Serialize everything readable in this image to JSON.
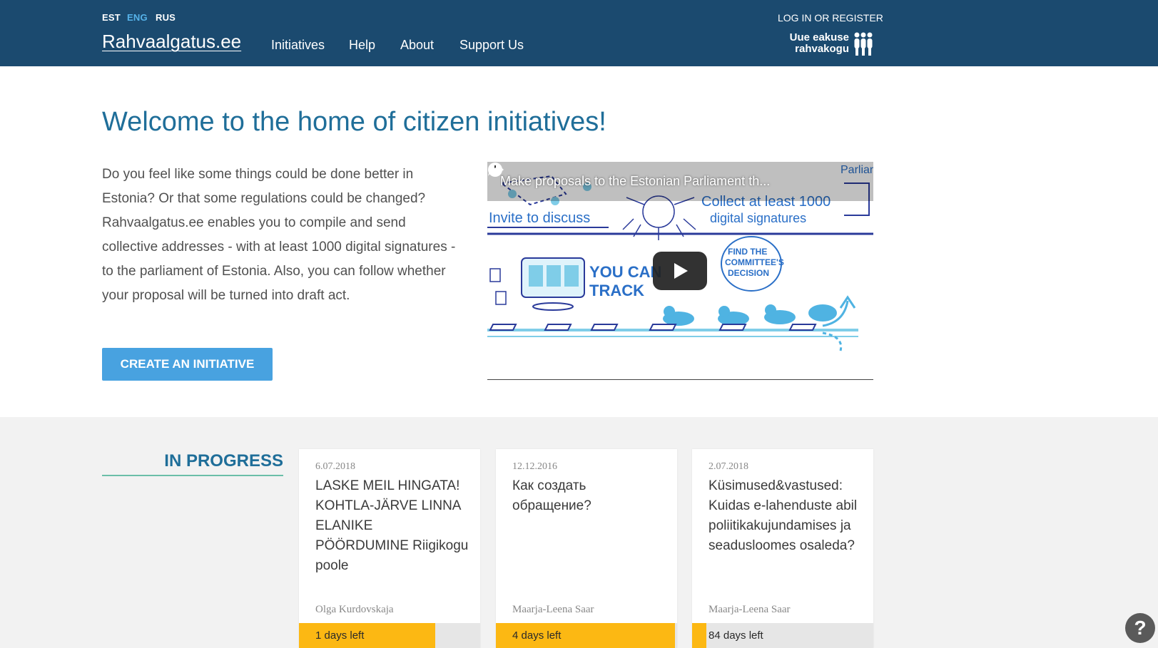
{
  "header": {
    "languages": [
      "EST",
      "ENG",
      "RUS"
    ],
    "active_language": "ENG",
    "logo": "Rahvaalgatus.ee",
    "nav": [
      "Initiatives",
      "Help",
      "About",
      "Support Us"
    ],
    "login": "LOG IN OR REGISTER",
    "brand": "Uue eakuse\nrahvakogu"
  },
  "hero": {
    "title": "Welcome to the home of citizen initiatives!",
    "intro": "Do you feel like some things could be done better in Estonia? Or that some regulations could be changed? Rahvaalgatus.ee enables you to compile and send collective addresses - with at least 1000 digital signatures - to the parliament of Estonia. Also, you can follow whether your proposal will be turned into draft act.",
    "cta": "CREATE AN INITIATIVE",
    "video": {
      "title": "Make proposals to the Estonian Parliament th...",
      "scene_labels": [
        "Invite to discuss",
        "Collect at least 1000",
        "digital signatures",
        "YOU CAN",
        "TRACK",
        "FIND THE",
        "COMMITTEE'S",
        "DECISION",
        "Parliam"
      ]
    }
  },
  "in_progress": {
    "title": "IN PROGRESS",
    "cards": [
      {
        "date": "6.07.2018",
        "title": "LASKE MEIL HINGATA! KOHTLA-JÄRVE LINNA ELANIKE PÖÖRDUMINE Riigikogu poole",
        "author": "Olga Kurdovskaja",
        "days_left": "1 days left",
        "progress": 0.75
      },
      {
        "date": "12.12.2016",
        "title": "Как создать обращение?",
        "author": "Maarja-Leena Saar",
        "days_left": "4 days left",
        "progress": 0.99
      },
      {
        "date": "2.07.2018",
        "title": "Küsimused&vastused: Kuidas e-lahenduste abil poliitikakujundamises ja seadusloomes osaleda?",
        "author": "Maarja-Leena Saar",
        "days_left": "84 days left",
        "progress": 0.08
      }
    ]
  },
  "help": "?",
  "colors": {
    "header_bg": "#1b4a6f",
    "accent": "#48a2e0",
    "title": "#1f6e99",
    "progress": "#fcb813"
  }
}
